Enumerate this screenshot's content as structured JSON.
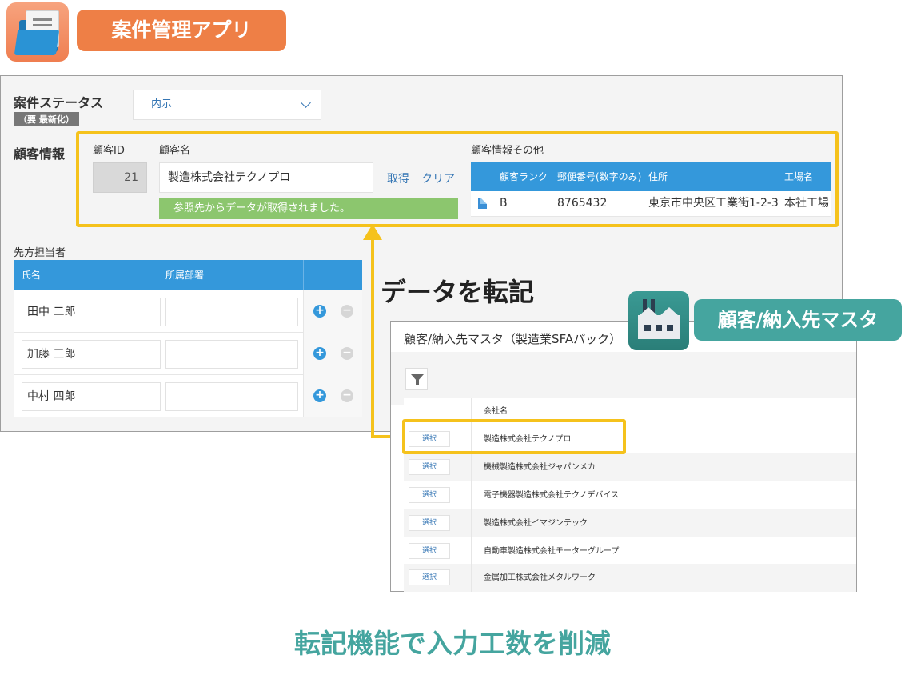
{
  "app": {
    "title": "案件管理アプリ",
    "colors": {
      "accent": "#ee7f46",
      "primary_blue": "#3498db",
      "highlight": "#f5c21c",
      "teal": "#45a59f",
      "success": "#8cc66e"
    }
  },
  "status": {
    "label": "案件ステータス",
    "note": "（要 最新化）",
    "selected": "内示"
  },
  "customer": {
    "section_label": "顧客情報",
    "id_label": "顧客ID",
    "id_value": "21",
    "name_label": "顧客名",
    "name_value": "製造株式会社テクノプロ",
    "fetch_link": "取得",
    "clear_link": "クリア",
    "success_message": "参照先からデータが取得されました。",
    "other": {
      "label": "顧客情報その他",
      "headers": [
        "顧客ランク",
        "郵便番号(数字のみ)",
        "住所",
        "工場名"
      ],
      "row": [
        "B",
        "8765432",
        "東京市中央区工業街1-2-3",
        "本社工場"
      ]
    }
  },
  "contacts": {
    "label": "先方担当者",
    "headers": [
      "氏名",
      "所属部署"
    ],
    "rows": [
      "田中 二郎",
      "加藤 三郎",
      "中村 四郎"
    ],
    "add_symbol": "+",
    "remove_symbol": "−"
  },
  "transfer": {
    "label": "データを転記"
  },
  "master": {
    "badge_label": "顧客/納入先マスタ",
    "window_title": "顧客/納入先マスタ（製造業SFAパック）",
    "column_header": "会社名",
    "select_label": "選択",
    "rows": [
      "製造株式会社テクノプロ",
      "機械製造株式会社ジャパンメカ",
      "電子機器製造株式会社テクノデバイス",
      "製造株式会社イマジンテック",
      "自動車製造株式会社モーターグループ",
      "金属加工株式会社メタルワーク"
    ]
  },
  "caption": "転記機能で入力工数を削減"
}
